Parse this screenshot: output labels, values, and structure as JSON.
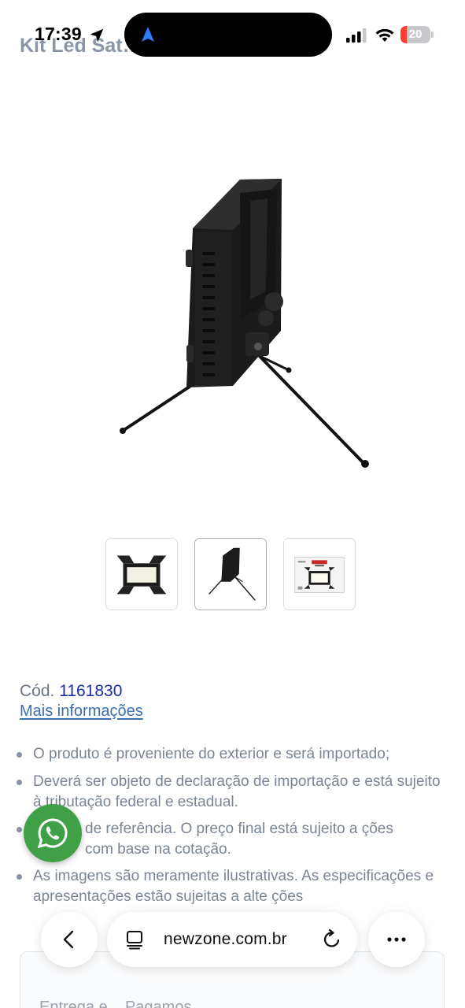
{
  "status_bar": {
    "time": "17:39",
    "battery_level": "20",
    "battery_fraction": 0.2,
    "icons": [
      "location-arrow-icon",
      "navigation-arrow-icon",
      "cellular-signal-icon",
      "wifi-icon",
      "battery-icon"
    ]
  },
  "product": {
    "title": "Kit Led Sat… …ofessional RGB",
    "main_image_alt": "LED panel light on tripod stand",
    "thumbnails": [
      {
        "alt": "LED panel front with barn doors",
        "active": false
      },
      {
        "alt": "LED panel side on tripod",
        "active": true
      },
      {
        "alt": "LED panel retail box",
        "active": false
      }
    ],
    "code_label": "Cód.",
    "code_value": "1161830",
    "more_info": "Mais informações"
  },
  "notices": [
    "O produto é proveniente do exterior e será importado;",
    "Deverá ser objeto de declaração de importação e está sujeito à tributação federal e estadual.",
    "de referência. O preço final está sujeito a ções com base na cotação.",
    "As imagens são meramente ilustrativas. As especificações e apresentações estão sujeitas a alte ções"
  ],
  "floating": {
    "whatsapp_icon": "whatsapp-icon",
    "color": "#3fa047"
  },
  "browser_bar": {
    "url": "newzone.com.br",
    "icons": [
      "chevron-left-icon",
      "tabs-icon",
      "reload-icon",
      "ellipsis-icon"
    ]
  },
  "footer_ghost": "Entrega e... Pagamos"
}
